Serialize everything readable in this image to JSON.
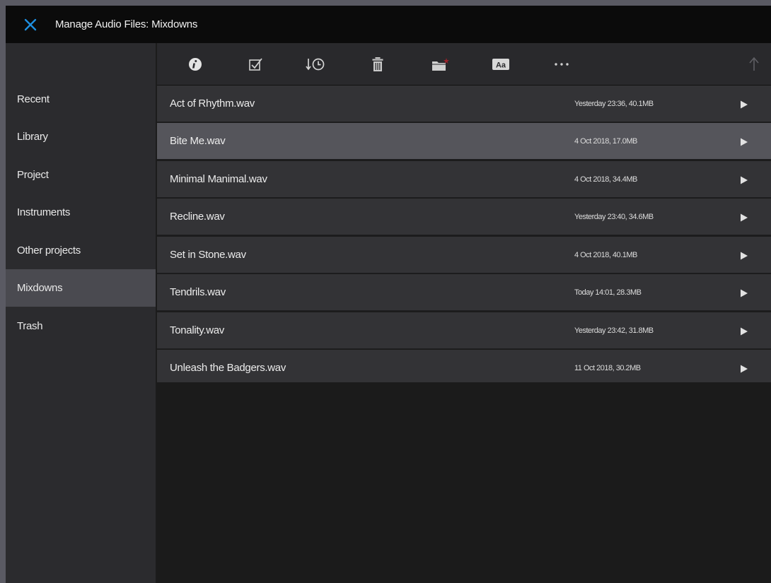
{
  "window": {
    "title": "Manage Audio Files: Mixdowns",
    "close_icon": "close-icon",
    "accent_color": "#1e8fe0"
  },
  "sidebar": {
    "items": [
      {
        "label": "Recent"
      },
      {
        "label": "Library"
      },
      {
        "label": "Project"
      },
      {
        "label": "Instruments"
      },
      {
        "label": "Other projects"
      },
      {
        "label": "Mixdowns",
        "active": true
      },
      {
        "label": "Trash"
      }
    ]
  },
  "toolbar": {
    "icons": [
      "info-icon",
      "select-icon",
      "sort-by-time-icon",
      "trash-icon",
      "folder-icon",
      "text-size-icon",
      "more-icon",
      "up-arrow-icon"
    ]
  },
  "files": [
    {
      "name": "Act of Rhythm.wav",
      "meta": "Yesterday 23:36, 40.1MB"
    },
    {
      "name": "Bite Me.wav",
      "meta": "4 Oct 2018, 17.0MB",
      "selected": true
    },
    {
      "name": "Minimal Manimal.wav",
      "meta": "4 Oct 2018, 34.4MB"
    },
    {
      "name": "Recline.wav",
      "meta": "Yesterday 23:40, 34.6MB"
    },
    {
      "name": "Set in Stone.wav",
      "meta": "4 Oct 2018, 40.1MB"
    },
    {
      "name": "Tendrils.wav",
      "meta": "Today 14:01, 28.3MB"
    },
    {
      "name": "Tonality.wav",
      "meta": "Yesterday 23:42, 31.8MB"
    },
    {
      "name": "Unleash the Badgers.wav",
      "meta": "11 Oct 2018, 30.2MB"
    }
  ]
}
